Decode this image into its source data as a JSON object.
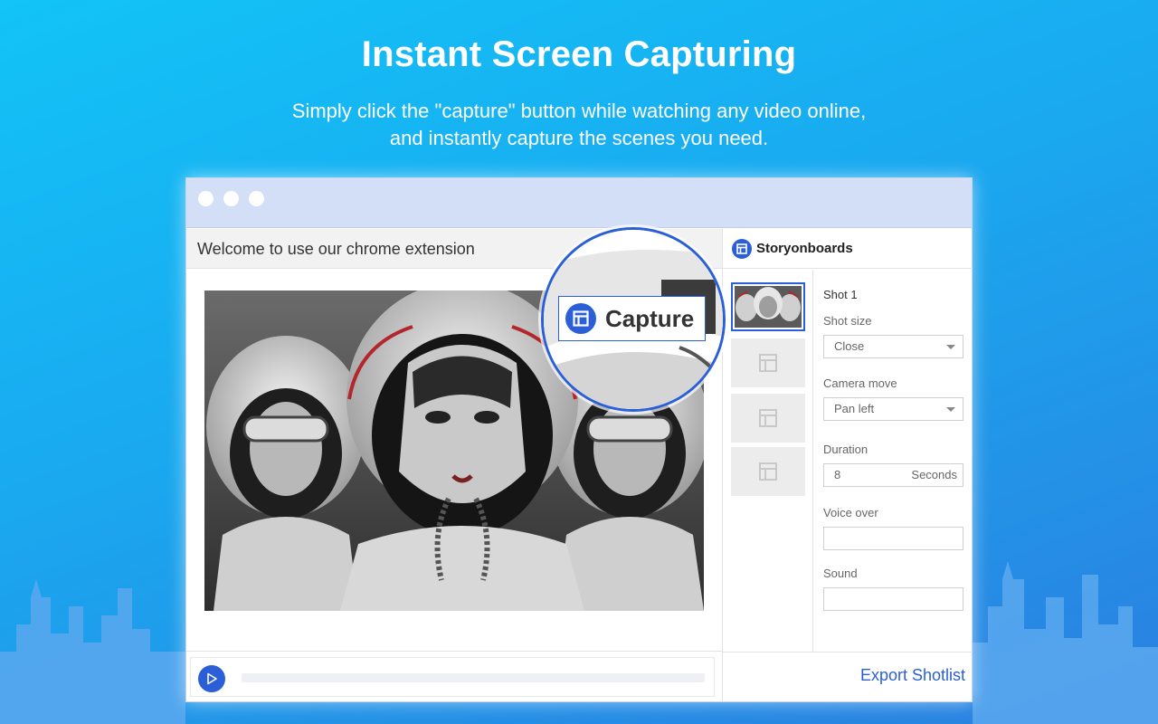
{
  "hero": {
    "title": "Instant Screen Capturing",
    "subtitle_line1": "Simply click the \"capture\" button while watching any video online,",
    "subtitle_line2": "and instantly capture the scenes you need."
  },
  "video_pane": {
    "welcome_text": "Welcome to use our chrome extension"
  },
  "capture_button": {
    "label": "Capture",
    "icon": "storyboard-icon"
  },
  "panel": {
    "brand": "Storyonboards",
    "shot_title": "Shot 1",
    "fields": {
      "shot_size_label": "Shot size",
      "shot_size_value": "Close",
      "camera_move_label": "Camera move",
      "camera_move_value": "Pan left",
      "duration_label": "Duration",
      "duration_value": "8",
      "duration_unit": "Seconds",
      "voice_over_label": "Voice over",
      "voice_over_value": "",
      "sound_label": "Sound",
      "sound_value": ""
    },
    "export_label": "Export Shotlist"
  },
  "colors": {
    "accent": "#2a5fd8",
    "background_start": "#12c4f7",
    "background_end": "#2b7fe0",
    "titlebar": "#d3dff6"
  }
}
